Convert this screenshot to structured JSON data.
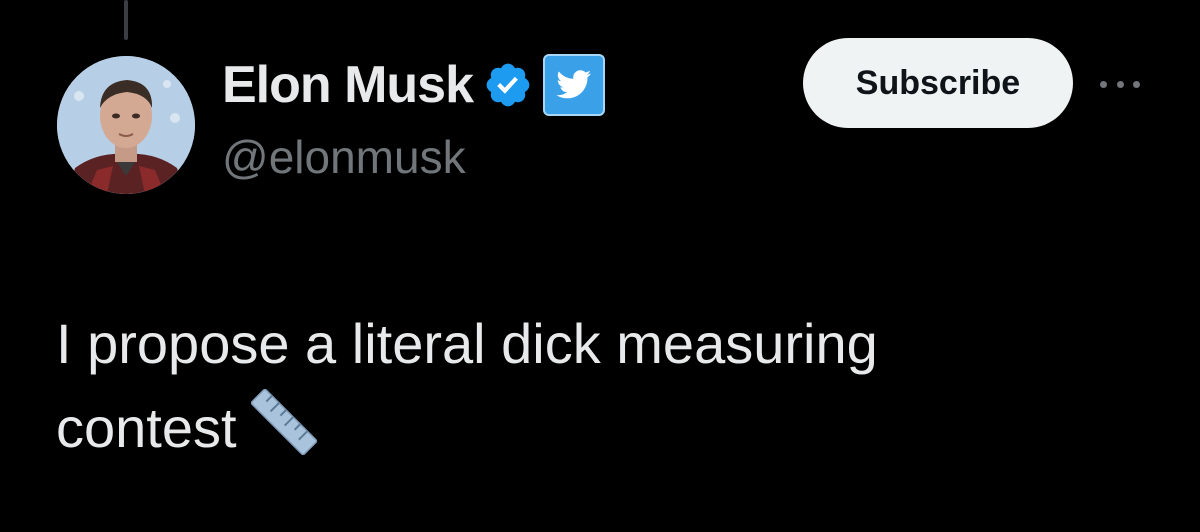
{
  "author": {
    "display_name": "Elon Musk",
    "handle": "@elonmusk",
    "verified_badge": "verified-check-icon",
    "affiliate_badge": "twitter-bird-icon",
    "verified_color": "#1d9bf0"
  },
  "actions": {
    "subscribe_label": "Subscribe",
    "more_icon": "more-horizontal-icon"
  },
  "tweet": {
    "line1": "I propose a literal dick measuring",
    "line2": "contest",
    "emoji": "straight-ruler-icon"
  },
  "colors": {
    "background": "#000000",
    "text_primary": "#e7e9ea",
    "text_secondary": "#71767b",
    "button_bg": "#eff3f4",
    "accent": "#1d9bf0"
  }
}
